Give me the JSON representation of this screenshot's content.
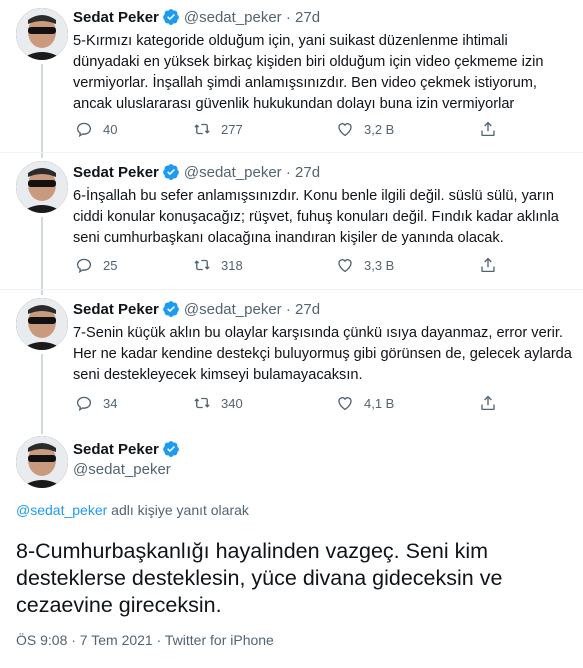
{
  "tweets": [
    {
      "name": "Sedat Peker",
      "handle": "@sedat_peker",
      "time": "27d",
      "text": "5-Kırmızı kategoride olduğum için, yani suikast düzenlenme ihtimali dünyadaki en yüksek birkaç kişiden biri olduğum için video çekmeme izin vermiyorlar. İnşallah şimdi anlamışsınızdır. Ben video çekmek istiyorum, ancak uluslararası güvenlik hukukundan dolayı buna izin vermiyorlar",
      "replies": "40",
      "retweets": "277",
      "likes": "3,2 B"
    },
    {
      "name": "Sedat Peker",
      "handle": "@sedat_peker",
      "time": "27d",
      "text": "6-İnşallah bu sefer anlamışsınızdır. Konu benle ilgili değil. süslü sülü, yarın ciddi konular konuşacağız; rüşvet, fuhuş konuları değil. Fındık kadar aklınla seni cumhurbaşkanı olacağına inandıran kişiler de yanında olacak.",
      "replies": "25",
      "retweets": "318",
      "likes": "3,3 B"
    },
    {
      "name": "Sedat Peker",
      "handle": "@sedat_peker",
      "time": "27d",
      "text": "7-Senin küçük aklın bu olaylar karşısında çünkü ısıya dayanmaz, error verir. Her ne kadar kendine destekçi buluyormuş gibi görünsen de, gelecek aylarda seni destekleyecek kimseyi bulamayacaksın.",
      "replies": "34",
      "retweets": "340",
      "likes": "4,1 B"
    }
  ],
  "main": {
    "name": "Sedat Peker",
    "handle": "@sedat_peker",
    "reply_mention": "@sedat_peker",
    "reply_suffix": " adlı kişiye yanıt olarak",
    "text": "8-Cumhurbaşkanlığı hayalinden vazgeç. Seni kim desteklerse desteklesin, yüce divana gideceksin ve cezaevine gireceksin.",
    "timestamp": "ÖS 9:08 · 7 Tem 2021 · Twitter for iPhone"
  },
  "icons": {
    "reply": "reply-icon",
    "retweet": "retweet-icon",
    "like": "heart-icon",
    "share": "share-icon",
    "verified": "verified-badge-icon"
  },
  "colors": {
    "accent": "#1d9bf0",
    "secondary_text": "#536471",
    "divider": "#eff3f4"
  }
}
